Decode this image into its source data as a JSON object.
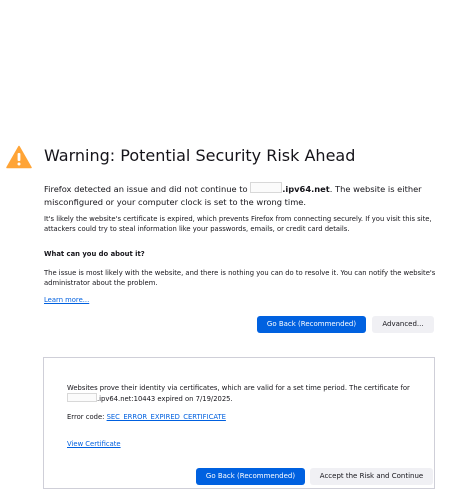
{
  "header": {
    "icon": "warning-triangle-icon",
    "title": "Warning: Potential Security Risk Ahead"
  },
  "intro": {
    "text_before": "Firefox detected an issue and did not continue to ",
    "host": ".ipv64.net",
    "text_after": ". The website is either misconfigured or your computer clock is set to the wrong time."
  },
  "explanation": "It's likely the website's certificate is expired, which prevents Firefox from connecting securely. If you visit this site, attackers could try to steal information like your passwords, emails, or credit card details.",
  "what_to_do": {
    "heading": "What can you do about it?",
    "text": "The issue is most likely with the website, and there is nothing you can do to resolve it. You can notify the website's administrator about the problem.",
    "learn_more": "Learn more..."
  },
  "actions": {
    "go_back": "Go Back (Recommended)",
    "advanced": "Advanced..."
  },
  "advanced_panel": {
    "cert_text_before": "Websites prove their identity via certificates, which are valid for a set time period. The certificate for ",
    "cert_host": ".ipv64.net:10443",
    "cert_text_after": " expired on 7/19/2025.",
    "error_code_label": "Error code: ",
    "error_code": "SEC_ERROR_EXPIRED_CERTIFICATE",
    "view_certificate": "View Certificate",
    "go_back": "Go Back (Recommended)",
    "accept": "Accept the Risk and Continue"
  },
  "colors": {
    "warning": "#ffa436",
    "primary_button": "#0061e0",
    "link": "#0060df"
  }
}
